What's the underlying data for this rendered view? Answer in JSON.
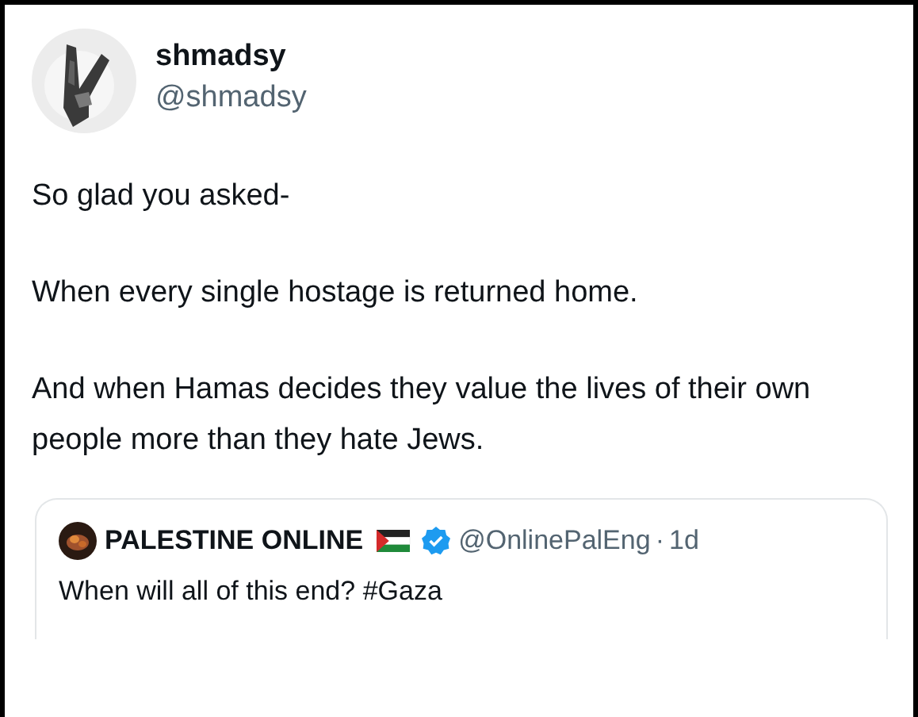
{
  "author": {
    "name": "shmadsy",
    "handle": "@shmadsy"
  },
  "paragraphs": [
    "So glad you asked-",
    "When every single hostage is returned home.",
    "And when Hamas decides they value the lives of their own people more than they hate Jews."
  ],
  "quoted_tweet": {
    "name": "PALESTINE ONLINE",
    "verified": true,
    "handle": "@OnlinePalEng",
    "separator": "·",
    "time": "1d",
    "text": "When will all of this end? #Gaza"
  }
}
